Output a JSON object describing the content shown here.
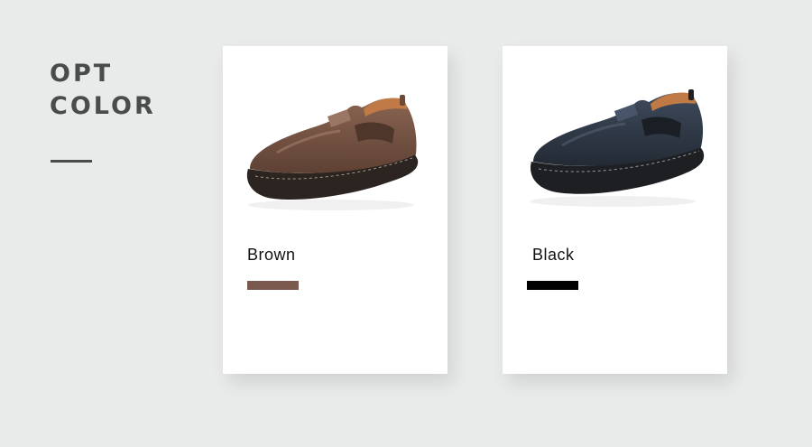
{
  "heading": {
    "line1": "OPT",
    "line2": "COLOR"
  },
  "options": [
    {
      "name": "Brown",
      "swatch_color": "#7a5a4e",
      "shoe_upper_color": "#7a5646",
      "shoe_sole_color": "#2c2420",
      "icon": "brown-slip-on-shoe-image"
    },
    {
      "name": "Black",
      "swatch_color": "#000000",
      "shoe_upper_color": "#2f3a4a",
      "shoe_sole_color": "#1d1f22",
      "icon": "black-slip-on-shoe-image"
    }
  ]
}
